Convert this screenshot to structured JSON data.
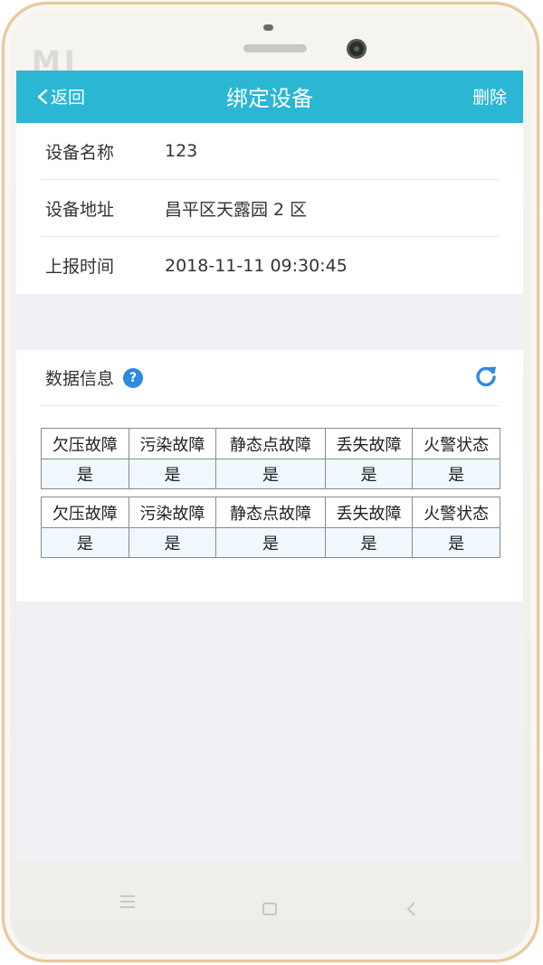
{
  "device": {
    "logo": "MI"
  },
  "header": {
    "back_label": "返回",
    "title": "绑定设备",
    "delete_label": "删除"
  },
  "info": {
    "rows": [
      {
        "label": "设备名称",
        "value": "123"
      },
      {
        "label": "设备地址",
        "value": "昌平区天露园 2 区"
      },
      {
        "label": "上报时间",
        "value": "2018-11-11 09:30:45"
      }
    ]
  },
  "data_section": {
    "title": "数据信息",
    "help_icon": "help-icon",
    "refresh_icon": "refresh-icon",
    "tables": [
      {
        "headers": [
          "欠压故障",
          "污染故障",
          "静态点故障",
          "丢失故障",
          "火警状态"
        ],
        "values": [
          "是",
          "是",
          "是",
          "是",
          "是"
        ]
      },
      {
        "headers": [
          "欠压故障",
          "污染故障",
          "静态点故障",
          "丢失故障",
          "火警状态"
        ],
        "values": [
          "是",
          "是",
          "是",
          "是",
          "是"
        ]
      }
    ]
  },
  "colors": {
    "topbar": "#2bb6d4",
    "help_icon": "#2d8ae0",
    "refresh_icon": "#2d8ae0",
    "value_cell_bg": "#eef8fd"
  }
}
